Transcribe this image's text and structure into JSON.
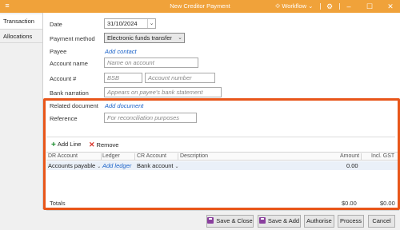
{
  "window": {
    "title": "New Creditor Payment",
    "workflow_label": "Workflow",
    "workflow_icon": "workflow-icon",
    "controls": [
      "settings-icon",
      "minimize-icon",
      "maximize-icon",
      "close-icon"
    ],
    "accent": "#f0a23a"
  },
  "tabs": [
    {
      "label": "Transaction",
      "active": true
    },
    {
      "label": "Allocations",
      "active": false
    }
  ],
  "form": {
    "date": {
      "label": "Date",
      "value": "31/10/2024"
    },
    "payment_method": {
      "label": "Payment method",
      "value": "Electronic funds transfer"
    },
    "payee": {
      "label": "Payee",
      "link": "Add contact"
    },
    "account_name": {
      "label": "Account name",
      "placeholder": "Name on account"
    },
    "account_num": {
      "label": "Account #",
      "bsb_placeholder": "BSB",
      "number_placeholder": "Account number"
    },
    "bank_narration": {
      "label": "Bank narration",
      "placeholder": "Appears on payee's bank statement"
    },
    "related_document": {
      "label": "Related document",
      "link": "Add document"
    },
    "reference": {
      "label": "Reference",
      "placeholder": "For reconciliation purposes"
    }
  },
  "toolbar": {
    "add_line": "Add Line",
    "remove": "Remove"
  },
  "grid": {
    "columns": [
      "DR Account",
      "Ledger",
      "CR Account",
      "Description",
      "Amount",
      "Incl. GST"
    ],
    "rows": [
      {
        "dr_account": "Accounts payable",
        "ledger": "Add ledger",
        "cr_account": "Bank account",
        "description": "",
        "amount": "0.00",
        "incl_gst": ""
      }
    ],
    "totals_label": "Totals",
    "totals_amount": "$0.00",
    "totals_gst": "$0.00"
  },
  "buttons": {
    "save_close": "Save & Close",
    "save_add": "Save & Add",
    "authorise": "Authorise",
    "process": "Process",
    "cancel": "Cancel"
  },
  "highlight_color": "#e8561a"
}
